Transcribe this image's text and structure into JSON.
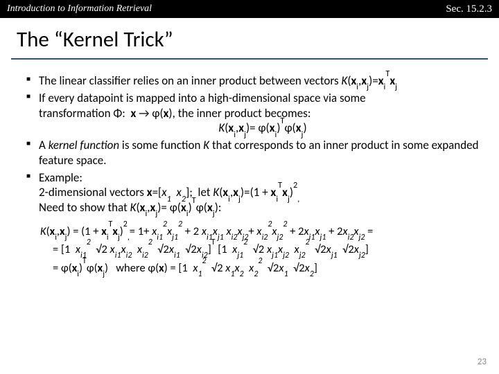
{
  "header": {
    "left": "Introduction to Information Retrieval",
    "right": "Sec. 15.2.3"
  },
  "title": "The “Kernel Trick”",
  "bullets": {
    "b1_pre": "The linear classifier relies on an inner product between vectors ",
    "b1_math": "K(x_i,x_j)=x_i^T x_j",
    "b2_l1": "If every datapoint is mapped into a high-dimensional space via some",
    "b2_prefix": "transformation Φ:  ",
    "b2_map": "x → φ(x)",
    "b2_suffix": ", the inner product becomes:",
    "b2_eq": "K(x_i,x_j)= φ(x_i)^Tφ(x_j)",
    "b3": "A kernel function is some function K that corresponds to an inner product in some expanded feature space.",
    "b4_label": "Example:",
    "b4_l1_pre": "2-dimensional vectors ",
    "b4_l1_vec": "x=[x_1  x_2]",
    "b4_l1_mid": ";  let ",
    "b4_l1_K": "K(x_i,x_j)=(1 + x_i^T x_j)^2",
    "b4_l1_comma": ",",
    "b4_l2_pre": "Need to show that ",
    "b4_l2_K": "K(x_i,x_j)= φ(x_i)^Tφ(x_j):"
  },
  "derivation": {
    "line1_lhs": "K(x_i,x_j) = (1 + x_i^T x_j)^2",
    "line1_rhs": "= 1+ x_{i1}^2 x_{j1}^2 + 2 x_{i1} x_{j1} x_{i2} x_{j2} + x_{i2}^2 x_{j2}^2 + 2 x_{i1} x_{j1} + 2 x_{i2} x_{j2} =",
    "line2": "= [1  x_{i1}^2  √2 x_{i1} x_{i2}  x_{i2}^2  √2 x_{i1}  √2 x_{i2}]^T [1  x_{j1}^2  √2 x_{j1} x_{j2}  x_{j2}^2  √2 x_{j1}  √2 x_{j2}]",
    "line3": "= φ(x_i)^T φ(x_j)   where φ(x) = [1  x_1^2  √2 x_1 x_2  x_2^2  √2 x_1  √2 x_2]"
  },
  "page_number": "23"
}
